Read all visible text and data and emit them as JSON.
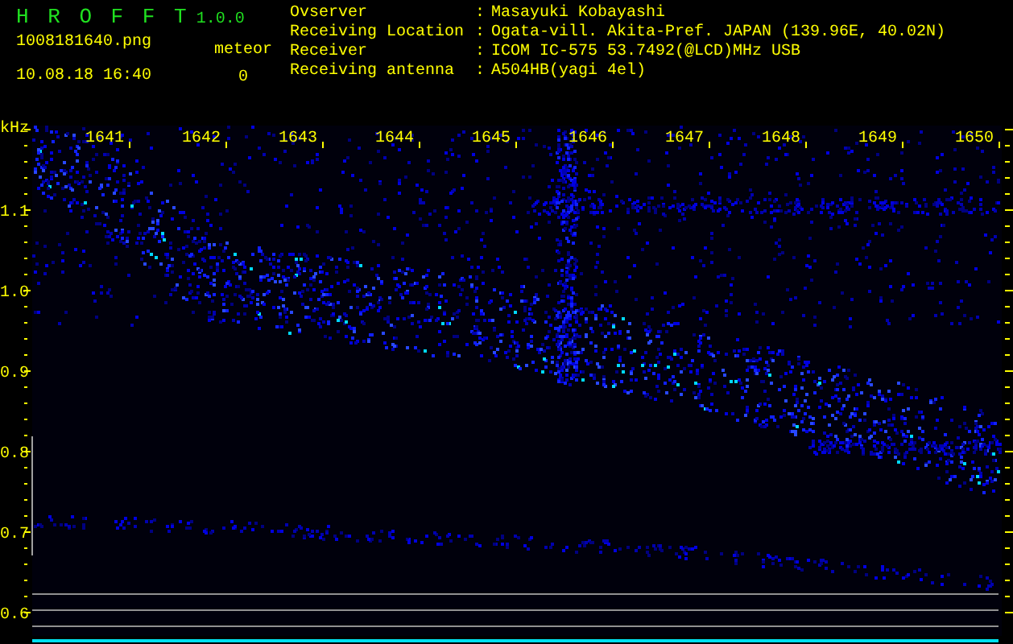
{
  "app": {
    "name": "H R O F F T",
    "version": "1.0.0"
  },
  "file": {
    "name": "1008181640.png",
    "datetime": "10.08.18 16:40"
  },
  "meteor": {
    "label": "meteor",
    "count": "0"
  },
  "info": [
    {
      "label": "Ovserver",
      "separator": ":",
      "value": "Masayuki Kobayashi"
    },
    {
      "label": "Receiving Location",
      "separator": ":",
      "value": "Ogata-vill. Akita-Pref. JAPAN (139.96E, 40.02N)"
    },
    {
      "label": "Receiver",
      "separator": ":",
      "value": "ICOM IC-575 53.7492(@LCD)MHz USB"
    },
    {
      "label": "Receiving antenna",
      "separator": ":",
      "value": "A504HB(yagi 4el)"
    }
  ],
  "spectrogram": {
    "y_unit": "kHz",
    "x_labels": [
      "1641",
      "1642",
      "1643",
      "1644",
      "1645",
      "1646",
      "1647",
      "1648",
      "1649",
      "1650"
    ],
    "y_labels": [
      "1.1",
      "1.0",
      "0.9",
      "0.8",
      "0.7",
      "0.6"
    ]
  }
}
